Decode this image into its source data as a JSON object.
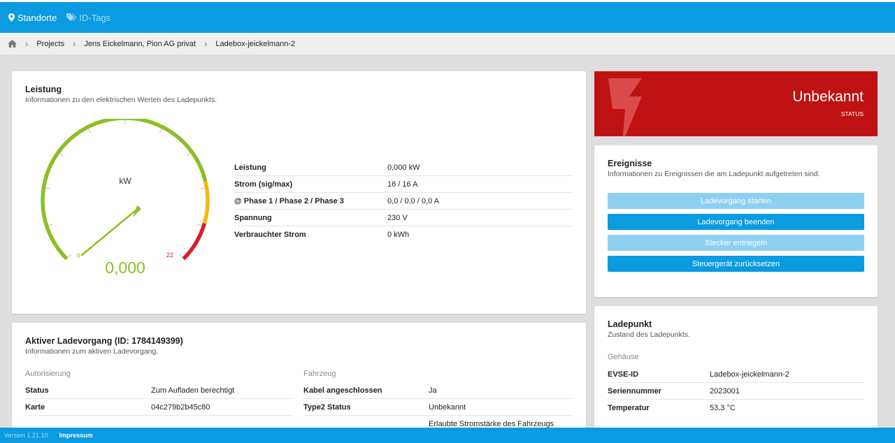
{
  "topnav": {
    "standorte": "Standorte",
    "idtags": "ID-Tags"
  },
  "breadcrumb": {
    "projects": "Projects",
    "owner": "Jens Eickelmann, Pion AG privat",
    "chargepoint": "Ladebox-jeickelmann-2"
  },
  "leistung": {
    "title": "Leistung",
    "subtitle": "Informationen zu den elektrischen Werten des Ladepunkts.",
    "gauge": {
      "unit": "kW",
      "min_label": "0",
      "max_label": "22",
      "min": 0,
      "max": 22,
      "value": 0.0,
      "value_text": "0,000"
    },
    "rows": [
      {
        "key": "Leistung",
        "value": "0,000 kW"
      },
      {
        "key": "Strom (sig/max)",
        "value": "16 / 16 A"
      },
      {
        "key": "@ Phase 1 / Phase 2 / Phase 3",
        "value": "0,0 / 0,0 / 0,0 A"
      },
      {
        "key": "Spannung",
        "value": "230 V"
      },
      {
        "key": "Verbrauchter Strom",
        "value": "0 kWh"
      }
    ]
  },
  "status": {
    "value": "Unbekannt",
    "label": "STATUS",
    "color": "#c01112"
  },
  "ereignisse": {
    "title": "Ereignisse",
    "subtitle": "Informationen zu Ereignissen die am Ladepunkt aufgetreten sind.",
    "buttons": [
      {
        "label": "Ladevorgang starten",
        "enabled": false
      },
      {
        "label": "Ladevorgang beenden",
        "enabled": true
      },
      {
        "label": "Stecker entriegeln",
        "enabled": false
      },
      {
        "label": "Steuergerät zurücksetzen",
        "enabled": true
      }
    ]
  },
  "aktiv": {
    "title": "Aktiver Ladevorgang (ID: 1784149399)",
    "subtitle": "Informationen zum aktiven Ladevorgang.",
    "autorisierung": {
      "label": "Autorisierung",
      "rows": [
        {
          "key": "Status",
          "value": "Zum Aufladen berechtigt"
        },
        {
          "key": "Karte",
          "value": "04c279b2b45c80"
        }
      ]
    },
    "fahrzeug": {
      "label": "Fahrzeug",
      "rows": [
        {
          "key": "Kabel angeschlossen",
          "value": "Ja"
        },
        {
          "key": "Type2 Status",
          "value": "Unbekannt"
        }
      ],
      "extra": "Erlaubte Stromstärke des Fahrzeugs"
    }
  },
  "ladepunkt": {
    "title": "Ladepunkt",
    "subtitle": "Zustand des Ladepunkts.",
    "gehaeuse_label": "Gehäuse",
    "rows": [
      {
        "key": "EVSE-ID",
        "value": "Ladebox-jeickelmann-2"
      },
      {
        "key": "Seriennummer",
        "value": "2023001"
      },
      {
        "key": "Temperatur",
        "value": "53,3 °C"
      }
    ]
  },
  "footer": {
    "version": "Version 1.21.10",
    "impressum": "Impressum"
  },
  "colors": {
    "brand_blue": "#0b9be0",
    "button_disabled": "#8ed0f2",
    "status_red": "#c01112",
    "gauge_green": "#8cbf26",
    "gauge_yellow": "#f2b90f",
    "gauge_red": "#d42020"
  }
}
